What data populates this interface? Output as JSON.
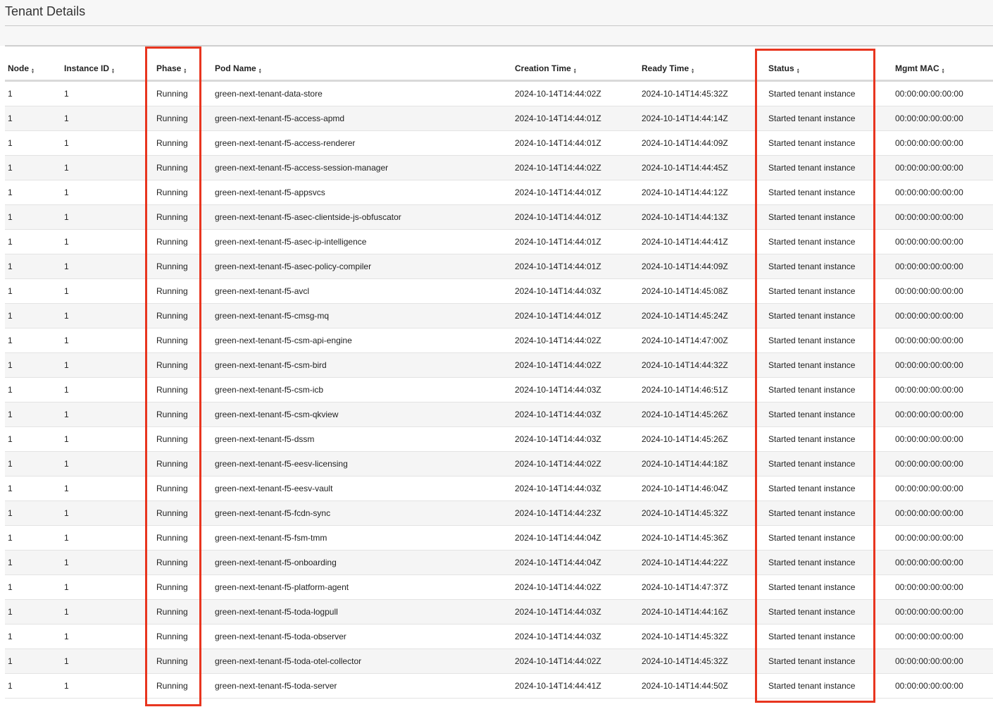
{
  "page": {
    "title": "Tenant Details"
  },
  "table": {
    "columns": [
      {
        "key": "node",
        "label": "Node"
      },
      {
        "key": "instance_id",
        "label": "Instance ID"
      },
      {
        "key": "phase",
        "label": "Phase"
      },
      {
        "key": "pod_name",
        "label": "Pod Name"
      },
      {
        "key": "creation_time",
        "label": "Creation Time"
      },
      {
        "key": "ready_time",
        "label": "Ready Time"
      },
      {
        "key": "status",
        "label": "Status"
      },
      {
        "key": "mgmt_mac",
        "label": "Mgmt MAC"
      }
    ],
    "sort_icon": "sort-arrows-icon",
    "rows": [
      [
        "1",
        "1",
        "Running",
        "green-next-tenant-data-store",
        "2024-10-14T14:44:02Z",
        "2024-10-14T14:45:32Z",
        "Started tenant instance",
        "00:00:00:00:00:00"
      ],
      [
        "1",
        "1",
        "Running",
        "green-next-tenant-f5-access-apmd",
        "2024-10-14T14:44:01Z",
        "2024-10-14T14:44:14Z",
        "Started tenant instance",
        "00:00:00:00:00:00"
      ],
      [
        "1",
        "1",
        "Running",
        "green-next-tenant-f5-access-renderer",
        "2024-10-14T14:44:01Z",
        "2024-10-14T14:44:09Z",
        "Started tenant instance",
        "00:00:00:00:00:00"
      ],
      [
        "1",
        "1",
        "Running",
        "green-next-tenant-f5-access-session-manager",
        "2024-10-14T14:44:02Z",
        "2024-10-14T14:44:45Z",
        "Started tenant instance",
        "00:00:00:00:00:00"
      ],
      [
        "1",
        "1",
        "Running",
        "green-next-tenant-f5-appsvcs",
        "2024-10-14T14:44:01Z",
        "2024-10-14T14:44:12Z",
        "Started tenant instance",
        "00:00:00:00:00:00"
      ],
      [
        "1",
        "1",
        "Running",
        "green-next-tenant-f5-asec-clientside-js-obfuscator",
        "2024-10-14T14:44:01Z",
        "2024-10-14T14:44:13Z",
        "Started tenant instance",
        "00:00:00:00:00:00"
      ],
      [
        "1",
        "1",
        "Running",
        "green-next-tenant-f5-asec-ip-intelligence",
        "2024-10-14T14:44:01Z",
        "2024-10-14T14:44:41Z",
        "Started tenant instance",
        "00:00:00:00:00:00"
      ],
      [
        "1",
        "1",
        "Running",
        "green-next-tenant-f5-asec-policy-compiler",
        "2024-10-14T14:44:01Z",
        "2024-10-14T14:44:09Z",
        "Started tenant instance",
        "00:00:00:00:00:00"
      ],
      [
        "1",
        "1",
        "Running",
        "green-next-tenant-f5-avcl",
        "2024-10-14T14:44:03Z",
        "2024-10-14T14:45:08Z",
        "Started tenant instance",
        "00:00:00:00:00:00"
      ],
      [
        "1",
        "1",
        "Running",
        "green-next-tenant-f5-cmsg-mq",
        "2024-10-14T14:44:01Z",
        "2024-10-14T14:45:24Z",
        "Started tenant instance",
        "00:00:00:00:00:00"
      ],
      [
        "1",
        "1",
        "Running",
        "green-next-tenant-f5-csm-api-engine",
        "2024-10-14T14:44:02Z",
        "2024-10-14T14:47:00Z",
        "Started tenant instance",
        "00:00:00:00:00:00"
      ],
      [
        "1",
        "1",
        "Running",
        "green-next-tenant-f5-csm-bird",
        "2024-10-14T14:44:02Z",
        "2024-10-14T14:44:32Z",
        "Started tenant instance",
        "00:00:00:00:00:00"
      ],
      [
        "1",
        "1",
        "Running",
        "green-next-tenant-f5-csm-icb",
        "2024-10-14T14:44:03Z",
        "2024-10-14T14:46:51Z",
        "Started tenant instance",
        "00:00:00:00:00:00"
      ],
      [
        "1",
        "1",
        "Running",
        "green-next-tenant-f5-csm-qkview",
        "2024-10-14T14:44:03Z",
        "2024-10-14T14:45:26Z",
        "Started tenant instance",
        "00:00:00:00:00:00"
      ],
      [
        "1",
        "1",
        "Running",
        "green-next-tenant-f5-dssm",
        "2024-10-14T14:44:03Z",
        "2024-10-14T14:45:26Z",
        "Started tenant instance",
        "00:00:00:00:00:00"
      ],
      [
        "1",
        "1",
        "Running",
        "green-next-tenant-f5-eesv-licensing",
        "2024-10-14T14:44:02Z",
        "2024-10-14T14:44:18Z",
        "Started tenant instance",
        "00:00:00:00:00:00"
      ],
      [
        "1",
        "1",
        "Running",
        "green-next-tenant-f5-eesv-vault",
        "2024-10-14T14:44:03Z",
        "2024-10-14T14:46:04Z",
        "Started tenant instance",
        "00:00:00:00:00:00"
      ],
      [
        "1",
        "1",
        "Running",
        "green-next-tenant-f5-fcdn-sync",
        "2024-10-14T14:44:23Z",
        "2024-10-14T14:45:32Z",
        "Started tenant instance",
        "00:00:00:00:00:00"
      ],
      [
        "1",
        "1",
        "Running",
        "green-next-tenant-f5-fsm-tmm",
        "2024-10-14T14:44:04Z",
        "2024-10-14T14:45:36Z",
        "Started tenant instance",
        "00:00:00:00:00:00"
      ],
      [
        "1",
        "1",
        "Running",
        "green-next-tenant-f5-onboarding",
        "2024-10-14T14:44:04Z",
        "2024-10-14T14:44:22Z",
        "Started tenant instance",
        "00:00:00:00:00:00"
      ],
      [
        "1",
        "1",
        "Running",
        "green-next-tenant-f5-platform-agent",
        "2024-10-14T14:44:02Z",
        "2024-10-14T14:47:37Z",
        "Started tenant instance",
        "00:00:00:00:00:00"
      ],
      [
        "1",
        "1",
        "Running",
        "green-next-tenant-f5-toda-logpull",
        "2024-10-14T14:44:03Z",
        "2024-10-14T14:44:16Z",
        "Started tenant instance",
        "00:00:00:00:00:00"
      ],
      [
        "1",
        "1",
        "Running",
        "green-next-tenant-f5-toda-observer",
        "2024-10-14T14:44:03Z",
        "2024-10-14T14:45:32Z",
        "Started tenant instance",
        "00:00:00:00:00:00"
      ],
      [
        "1",
        "1",
        "Running",
        "green-next-tenant-f5-toda-otel-collector",
        "2024-10-14T14:44:02Z",
        "2024-10-14T14:45:32Z",
        "Started tenant instance",
        "00:00:00:00:00:00"
      ],
      [
        "1",
        "1",
        "Running",
        "green-next-tenant-f5-toda-server",
        "2024-10-14T14:44:41Z",
        "2024-10-14T14:44:50Z",
        "Started tenant instance",
        "00:00:00:00:00:00"
      ]
    ]
  },
  "colors": {
    "highlight": "#e8351f",
    "stripe": "#f5f5f5",
    "header_bg": "#f7f7f7"
  }
}
